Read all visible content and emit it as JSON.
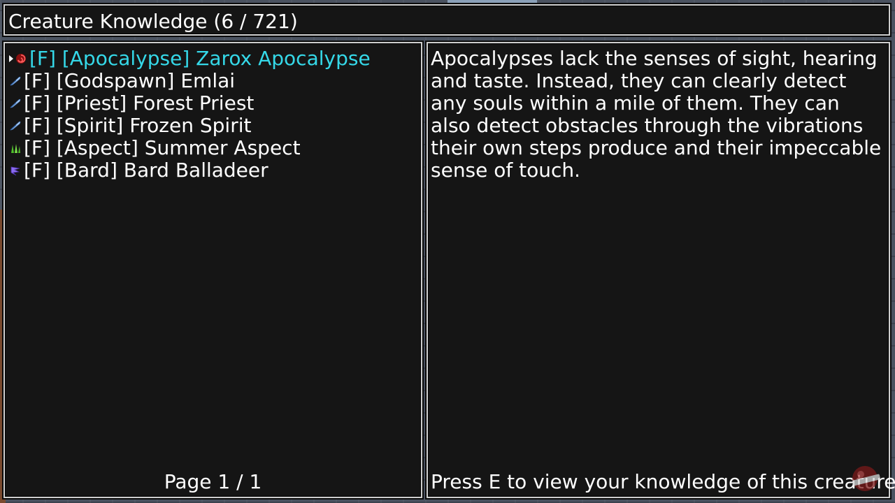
{
  "window": {
    "title": "Creature Knowledge (6 / 721)"
  },
  "list": {
    "items": [
      {
        "label": "[F] [Apocalypse] Zarox Apocalypse",
        "icon": "red-swirl-icon",
        "selected": true
      },
      {
        "label": "[F] [Godspawn] Emlai",
        "icon": "feather-icon",
        "selected": false
      },
      {
        "label": "[F] [Priest] Forest Priest",
        "icon": "feather-icon",
        "selected": false
      },
      {
        "label": "[F] [Spirit] Frozen Spirit",
        "icon": "feather-icon",
        "selected": false
      },
      {
        "label": "[F] [Aspect] Summer Aspect",
        "icon": "leaf-icon",
        "selected": false
      },
      {
        "label": "[F] [Bard] Bard Balladeer",
        "icon": "purple-wing-icon",
        "selected": false
      }
    ],
    "page_label": "Page 1 / 1"
  },
  "detail": {
    "description": "Apocalypses lack the senses of sight, hearing and taste. Instead, they can clearly detect any souls within a mile of them. They can also detect obstacles through the vibrations their own steps produce and their impeccable sense of touch.",
    "hint": "Press E to view your knowledge of this creature."
  },
  "colors": {
    "selected_text": "#35d8e8",
    "normal_text": "#ffffff",
    "panel_background": "#151515",
    "panel_border": "#cfcfcf"
  }
}
